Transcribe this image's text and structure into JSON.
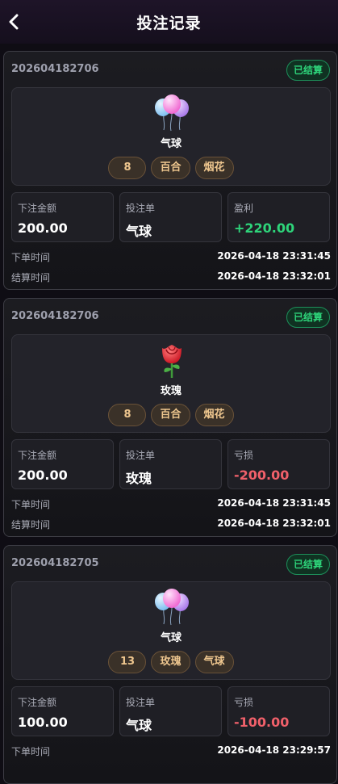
{
  "header": {
    "title": "投注记录",
    "back_icon": "chevron-left-icon"
  },
  "labels": {
    "bet_amount": "下注金额",
    "bet_item": "投注单",
    "order_time": "下单时间",
    "settle_time": "结算时间"
  },
  "colors": {
    "profit": "#2ed47a",
    "loss": "#f0606a",
    "status": "#2ed47a",
    "chip_text": "#efc78f"
  },
  "records": [
    {
      "order_no": "202604182706",
      "status": "已结算",
      "icon": "balloon-icon",
      "item_name": "气球",
      "chips": [
        "8",
        "百合",
        "烟花"
      ],
      "amount": "200.00",
      "bet_item": "气球",
      "result_label": "盈利",
      "result_value": "+220.00",
      "result_type": "profit",
      "order_time": "2026-04-18 23:31:45",
      "settle_time": "2026-04-18 23:32:01"
    },
    {
      "order_no": "202604182706",
      "status": "已结算",
      "icon": "rose-icon",
      "item_name": "玫瑰",
      "chips": [
        "8",
        "百合",
        "烟花"
      ],
      "amount": "200.00",
      "bet_item": "玫瑰",
      "result_label": "亏损",
      "result_value": "-200.00",
      "result_type": "loss",
      "order_time": "2026-04-18 23:31:45",
      "settle_time": "2026-04-18 23:32:01"
    },
    {
      "order_no": "202604182705",
      "status": "已结算",
      "icon": "balloon-icon",
      "item_name": "气球",
      "chips": [
        "13",
        "玫瑰",
        "气球"
      ],
      "amount": "100.00",
      "bet_item": "气球",
      "result_label": "亏损",
      "result_value": "-100.00",
      "result_type": "loss",
      "order_time": "2026-04-18 23:29:57",
      "settle_time": ""
    }
  ]
}
